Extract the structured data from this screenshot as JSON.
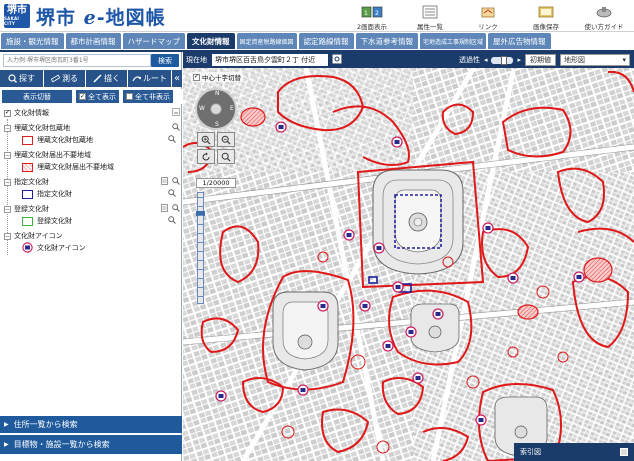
{
  "header": {
    "logo_text": "堺市",
    "logo_sub": "SAKAI CITY",
    "site_title": "堺市 ℯ-地図帳",
    "tools": [
      {
        "label": "2画面表示",
        "icon": "dual-screen-icon"
      },
      {
        "label": "属性一覧",
        "icon": "attribute-list-icon"
      },
      {
        "label": "リンク",
        "icon": "link-icon"
      },
      {
        "label": "画像保存",
        "icon": "image-save-icon"
      },
      {
        "label": "使い方ガイド",
        "icon": "guide-icon"
      }
    ]
  },
  "tabs": [
    {
      "label": "施設・観光情報",
      "active": false,
      "small": false
    },
    {
      "label": "都市計画情報",
      "active": false,
      "small": false
    },
    {
      "label": "ハザードマップ",
      "active": false,
      "small": false
    },
    {
      "label": "文化財情報",
      "active": true,
      "small": false
    },
    {
      "label": "固定資産税路線価図",
      "active": false,
      "small": true
    },
    {
      "label": "認定路線情報",
      "active": false,
      "small": false
    },
    {
      "label": "下水道参考情報",
      "active": false,
      "small": false
    },
    {
      "label": "宅地造成工事規制区域",
      "active": false,
      "small": true
    },
    {
      "label": "屋外広告物情報",
      "active": false,
      "small": false
    }
  ],
  "search": {
    "placeholder": "入力例:堺市堺区南瓦町3番1号",
    "button": "検索"
  },
  "actions": {
    "find": "探す",
    "measure": "測る",
    "draw": "描く",
    "route": "ルート",
    "collapse": "«"
  },
  "view": {
    "toggle": "表示切替",
    "show_all": "全て表示",
    "hide_all": "全て非表示"
  },
  "layers": {
    "root": "文化財情報",
    "groups": [
      {
        "label": "埋蔵文化財包蔵地",
        "item": "埋蔵文化財包蔵地",
        "swatch": "#e02020",
        "hatch": false
      },
      {
        "label": "埋蔵文化財届出不要地域",
        "item": "埋蔵文化財届出不要地域",
        "swatch": "#e02020",
        "hatch": true
      },
      {
        "label": "指定文化財",
        "item": "指定文化財",
        "swatch": "#2020a0",
        "hatch": false
      },
      {
        "label": "登録文化財",
        "item": "登録文化財",
        "swatch": "#40b040",
        "hatch": false
      },
      {
        "label": "文化財アイコン",
        "item": "文化財アイコン",
        "swatch": "#cc2266",
        "hatch": false
      }
    ]
  },
  "bottom_nav": [
    {
      "label": "住所一覧から検索"
    },
    {
      "label": "目標物・施設一覧から検索"
    }
  ],
  "map": {
    "current_label": "現在地",
    "location": "堺市堺区百舌鳥夕雲町２丁 付近",
    "opacity_label": "透過性",
    "initial_button": "初期値",
    "basemap": "地形図",
    "crosshair": "中心十字切替",
    "scale": "1/20000",
    "index_map": "索引図",
    "compass_n": "N",
    "compass_s": "S",
    "compass_w": "W",
    "compass_e": "E",
    "colors": {
      "heritage_line": "#e01818",
      "heritage_fill": "#f07070",
      "road": "#ffffff",
      "block": "#d4d4d4"
    }
  }
}
